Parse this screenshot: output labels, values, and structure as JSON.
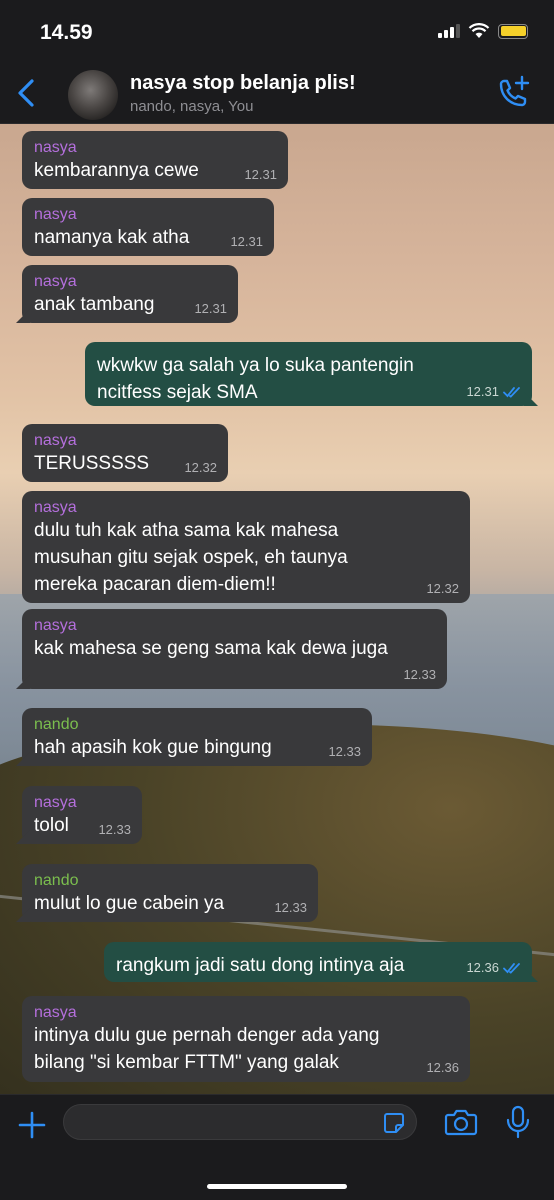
{
  "status_bar": {
    "time": "14.59"
  },
  "header": {
    "title": "nasya stop belanja plis!",
    "members": "nando, nasya, You"
  },
  "colors": {
    "accent": "#2f8ef4",
    "sender_nasya": "#b46fdc",
    "sender_nando": "#7bbe4e",
    "incoming_bubble": "#39393b",
    "outgoing_bubble": "#234e44"
  },
  "messages": [
    {
      "dir": "in",
      "sender": "nasya",
      "text": "kembarannya cewe",
      "time": "12.31"
    },
    {
      "dir": "in",
      "sender": "nasya",
      "text": "namanya kak atha",
      "time": "12.31"
    },
    {
      "dir": "in",
      "sender": "nasya",
      "text": "anak tambang",
      "time": "12.31"
    },
    {
      "dir": "out",
      "text": "wkwkw ga salah ya lo suka pantengin\nncitfess sejak SMA",
      "time": "12.31"
    },
    {
      "dir": "in",
      "sender": "nasya",
      "text": "TERUSSSSS",
      "time": "12.32"
    },
    {
      "dir": "in",
      "sender": "nasya",
      "text": "dulu tuh kak atha sama kak mahesa\nmusuhan gitu sejak ospek, eh taunya\nmereka pacaran diem-diem!!",
      "time": "12.32"
    },
    {
      "dir": "in",
      "sender": "nasya",
      "text": "kak mahesa se geng sama kak dewa juga",
      "time": "12.33"
    },
    {
      "dir": "in",
      "sender": "nando",
      "text": "hah apasih kok gue bingung",
      "time": "12.33"
    },
    {
      "dir": "in",
      "sender": "nasya",
      "text": "tolol",
      "time": "12.33"
    },
    {
      "dir": "in",
      "sender": "nando",
      "text": "mulut lo gue cabein ya",
      "time": "12.33"
    },
    {
      "dir": "out",
      "text": "rangkum jadi satu dong intinya aja",
      "time": "12.36"
    },
    {
      "dir": "in",
      "sender": "nasya",
      "text": "intinya dulu gue pernah denger ada yang\nbilang \"si kembar FTTM\" yang galak",
      "time": "12.36"
    }
  ],
  "icons": {
    "back": "chevron-left-icon",
    "call": "add-call-icon",
    "plus": "plus-icon",
    "sticker": "sticker-icon",
    "camera": "camera-icon",
    "mic": "microphone-icon",
    "read": "double-check-icon"
  }
}
